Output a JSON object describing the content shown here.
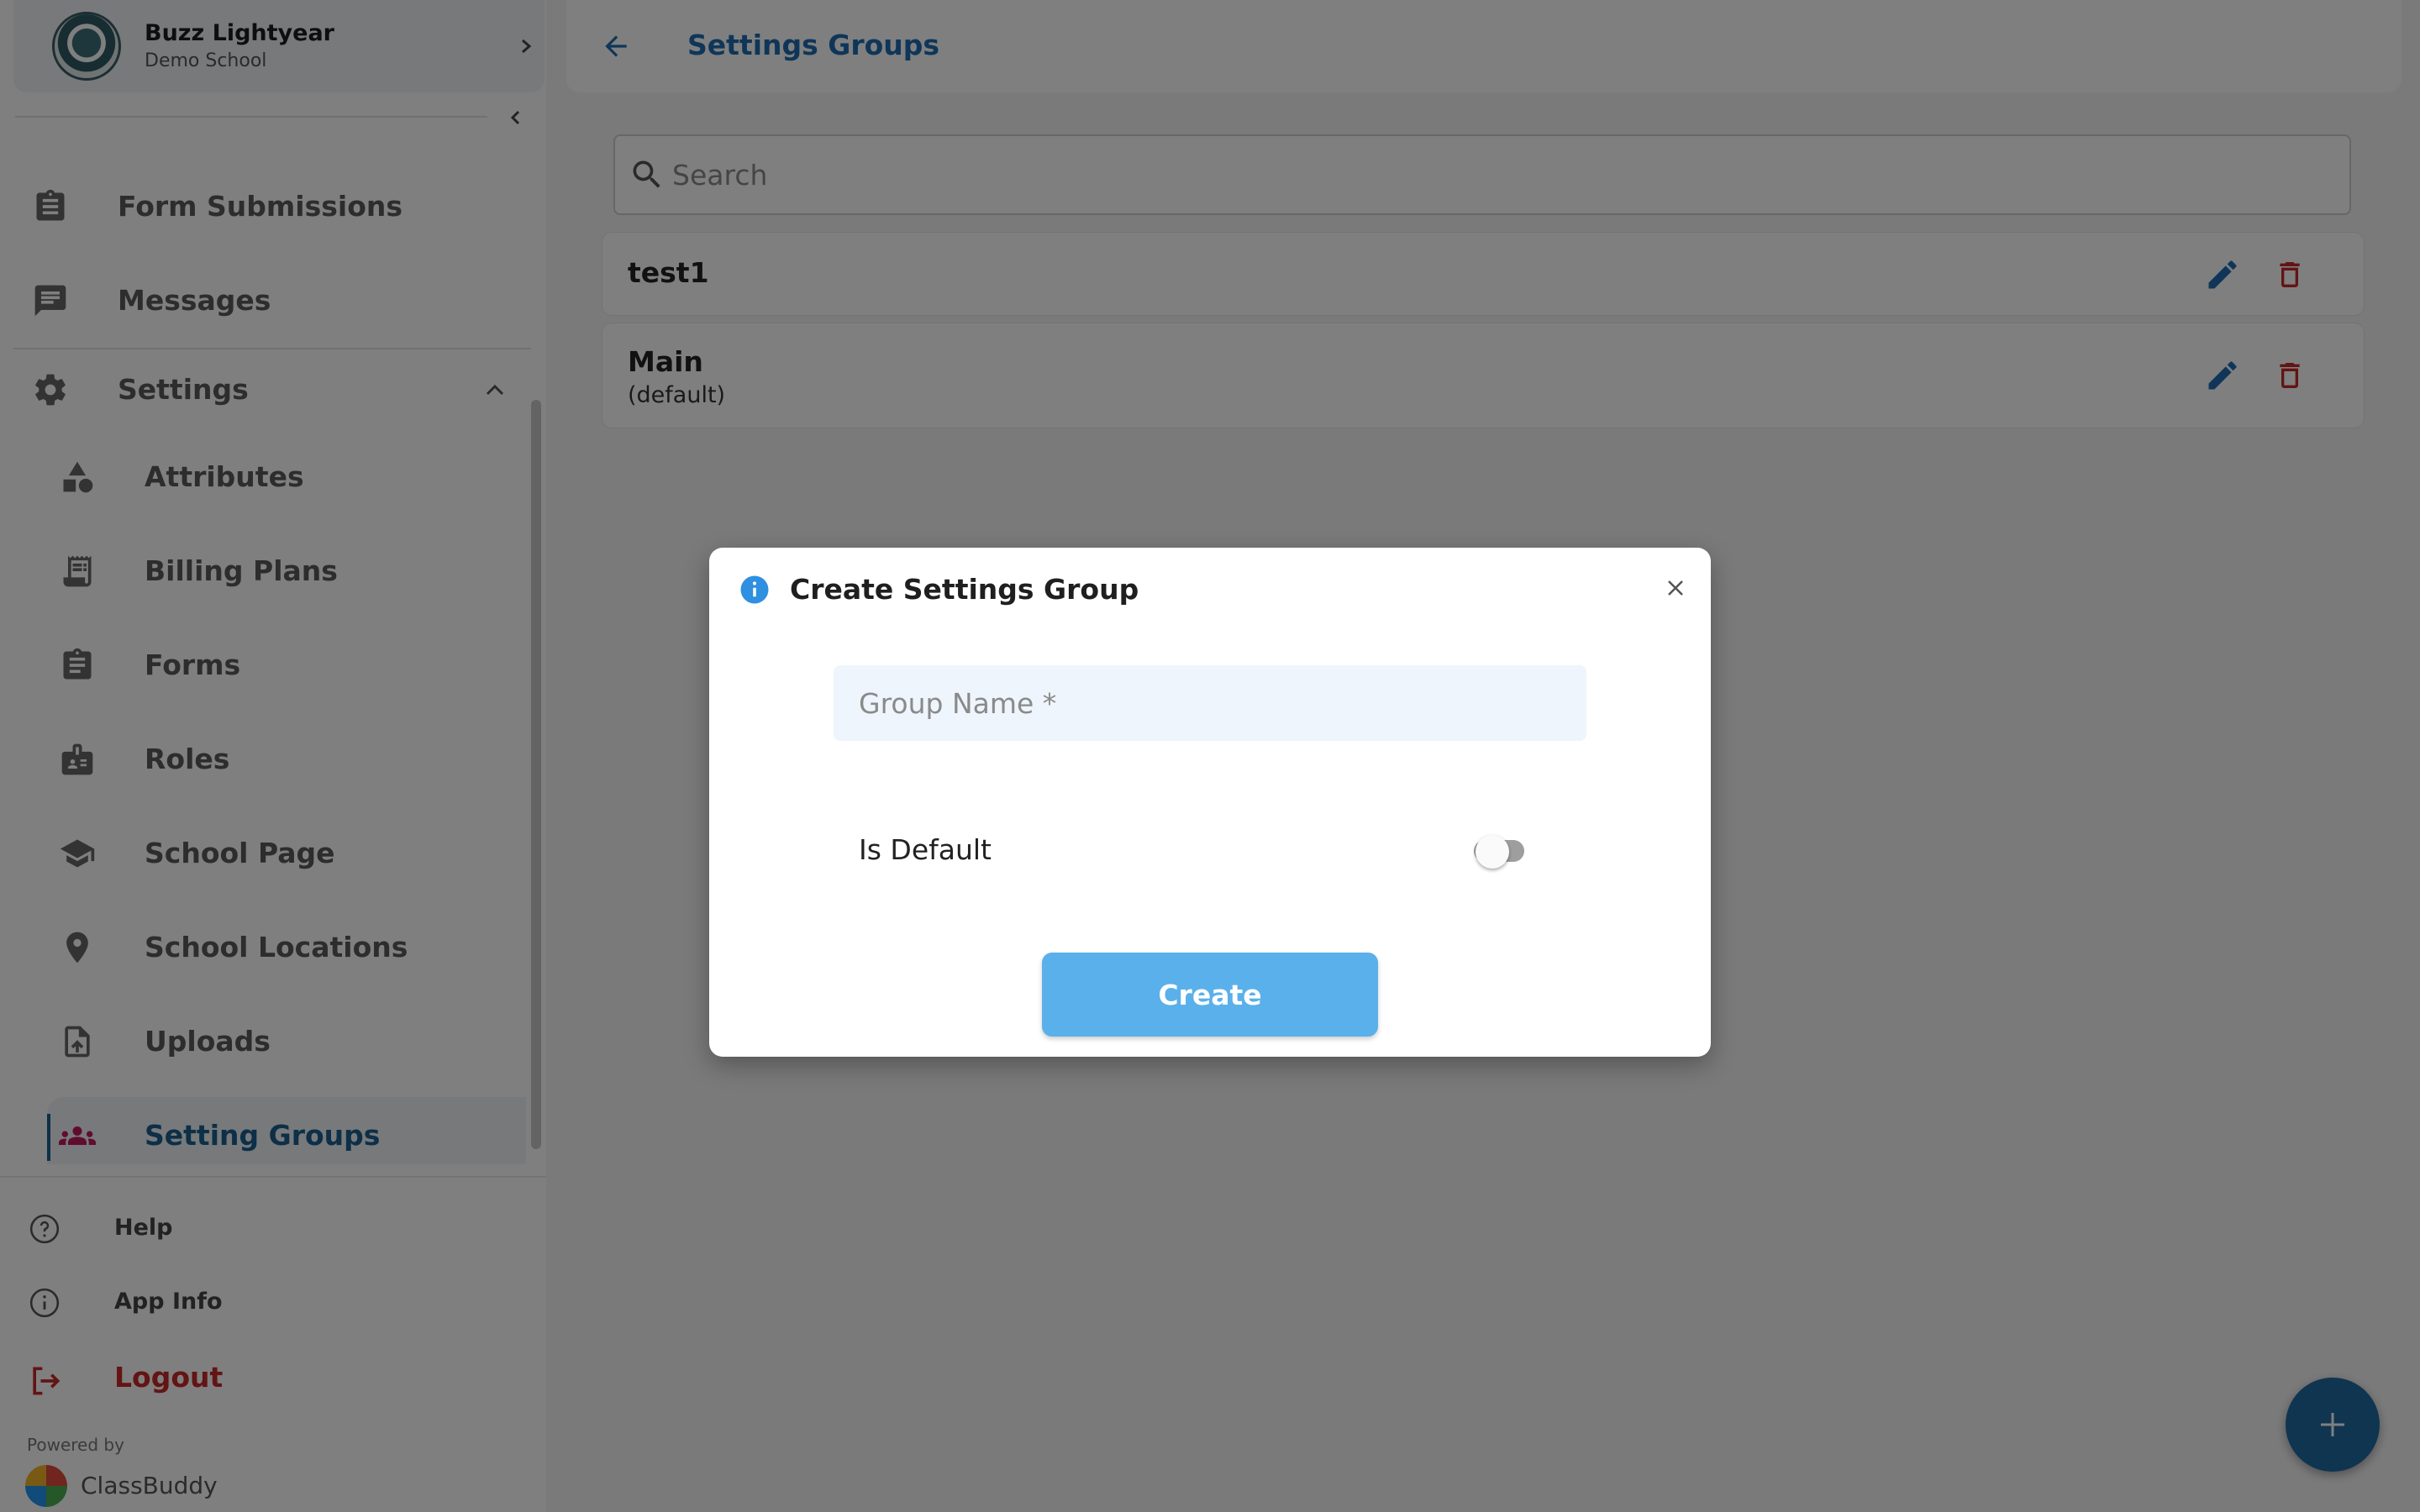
{
  "profile": {
    "name": "Buzz Lightyear",
    "school": "Demo School"
  },
  "sidebar": {
    "items": [
      {
        "label": "Form Submissions",
        "icon": "clipboard-list-icon"
      },
      {
        "label": "Messages",
        "icon": "chat-icon"
      },
      {
        "label": "Settings",
        "icon": "gear-icon"
      }
    ],
    "settings_items": [
      {
        "label": "Attributes",
        "icon": "shapes-icon"
      },
      {
        "label": "Billing Plans",
        "icon": "receipt-icon"
      },
      {
        "label": "Forms",
        "icon": "clipboard-icon"
      },
      {
        "label": "Roles",
        "icon": "id-badge-icon"
      },
      {
        "label": "School Page",
        "icon": "graduation-cap-icon"
      },
      {
        "label": "School Locations",
        "icon": "map-pin-icon"
      },
      {
        "label": "Uploads",
        "icon": "file-upload-icon"
      },
      {
        "label": "Setting Groups",
        "icon": "group-icon"
      }
    ],
    "footer": [
      {
        "label": "Help",
        "icon": "help-circle-icon"
      },
      {
        "label": "App Info",
        "icon": "info-circle-icon"
      },
      {
        "label": "Logout",
        "icon": "logout-icon"
      }
    ],
    "powered_by": "Powered by",
    "brand": "ClassBuddy"
  },
  "header": {
    "title": "Settings Groups"
  },
  "search": {
    "placeholder": "Search"
  },
  "groups": [
    {
      "name": "test1",
      "sub": ""
    },
    {
      "name": "Main",
      "sub": "(default)"
    }
  ],
  "dialog": {
    "title": "Create Settings Group",
    "group_name_placeholder": "Group Name *",
    "toggle_label": "Is Default",
    "is_default": false,
    "create_label": "Create"
  },
  "colors": {
    "accent": "#1f6cb0",
    "active_icon": "#c2185b",
    "danger": "#c62828",
    "create_button": "#5ab0ea"
  }
}
